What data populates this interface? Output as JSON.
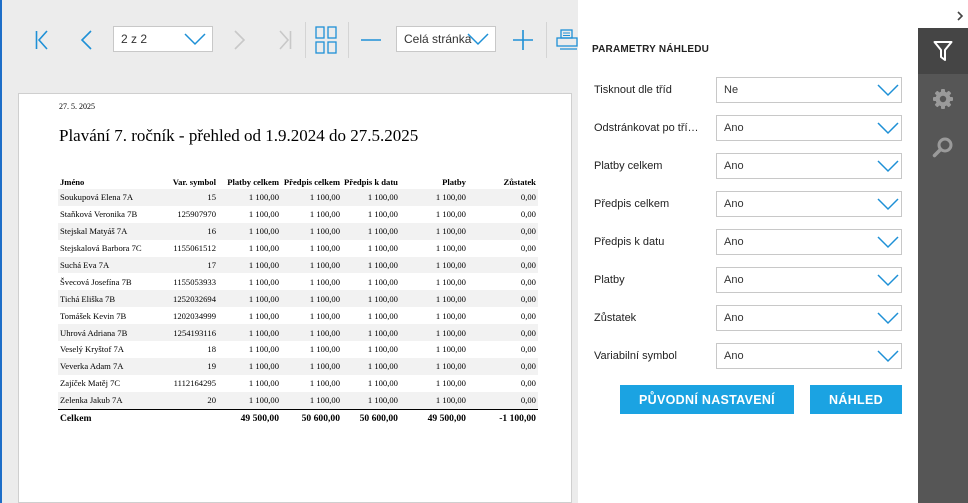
{
  "toolbar": {
    "page_select": "2 z 2",
    "zoom_select": "Celá stránka"
  },
  "report": {
    "date": "27. 5. 2025",
    "title": "Plavání 7. ročník - přehled od 1.9.2024 do 27.5.2025",
    "columns": [
      "Jméno",
      "Var. symbol",
      "Platby celkem",
      "Předpis celkem",
      "Předpis k datu",
      "Platby",
      "Zůstatek"
    ],
    "rows": [
      [
        "Soukupová Elena 7A",
        "15",
        "1 100,00",
        "1 100,00",
        "1 100,00",
        "1 100,00",
        "0,00"
      ],
      [
        "Staňková Veronika 7B",
        "125907970",
        "1 100,00",
        "1 100,00",
        "1 100,00",
        "1 100,00",
        "0,00"
      ],
      [
        "Stejskal Matyáš 7A",
        "16",
        "1 100,00",
        "1 100,00",
        "1 100,00",
        "1 100,00",
        "0,00"
      ],
      [
        "Stejskalová Barbora 7C",
        "1155061512",
        "1 100,00",
        "1 100,00",
        "1 100,00",
        "1 100,00",
        "0,00"
      ],
      [
        "Suchá Eva 7A",
        "17",
        "1 100,00",
        "1 100,00",
        "1 100,00",
        "1 100,00",
        "0,00"
      ],
      [
        "Švecová Josefína 7B",
        "1155053933",
        "1 100,00",
        "1 100,00",
        "1 100,00",
        "1 100,00",
        "0,00"
      ],
      [
        "Tichá Eliška 7B",
        "1252032694",
        "1 100,00",
        "1 100,00",
        "1 100,00",
        "1 100,00",
        "0,00"
      ],
      [
        "Tomášek Kevin 7B",
        "1202034999",
        "1 100,00",
        "1 100,00",
        "1 100,00",
        "1 100,00",
        "0,00"
      ],
      [
        "Uhrová Adriana 7B",
        "1254193116",
        "1 100,00",
        "1 100,00",
        "1 100,00",
        "1 100,00",
        "0,00"
      ],
      [
        "Veselý Kryštof 7A",
        "18",
        "1 100,00",
        "1 100,00",
        "1 100,00",
        "1 100,00",
        "0,00"
      ],
      [
        "Veverka Adam 7A",
        "19",
        "1 100,00",
        "1 100,00",
        "1 100,00",
        "1 100,00",
        "0,00"
      ],
      [
        "Zajíček Matěj 7C",
        "1112164295",
        "1 100,00",
        "1 100,00",
        "1 100,00",
        "1 100,00",
        "0,00"
      ],
      [
        "Zelenka Jakub 7A",
        "20",
        "1 100,00",
        "1 100,00",
        "1 100,00",
        "1 100,00",
        "0,00"
      ]
    ],
    "totals": [
      "Celkem",
      "",
      "49 500,00",
      "50 600,00",
      "50 600,00",
      "49 500,00",
      "-1 100,00"
    ]
  },
  "params": {
    "title": "PARAMETRY NÁHLEDU",
    "rows": [
      {
        "label": "Tisknout dle tříd",
        "value": "Ne"
      },
      {
        "label": "Odstránkovat po třídách",
        "value": "Ano"
      },
      {
        "label": "Platby celkem",
        "value": "Ano"
      },
      {
        "label": "Předpis celkem",
        "value": "Ano"
      },
      {
        "label": "Předpis k datu",
        "value": "Ano"
      },
      {
        "label": "Platby",
        "value": "Ano"
      },
      {
        "label": "Zůstatek",
        "value": "Ano"
      },
      {
        "label": "Variabilní symbol",
        "value": "Ano"
      }
    ],
    "reset_label": "PŮVODNÍ NASTAVENÍ",
    "preview_label": "NÁHLED"
  },
  "rail": {
    "icons": [
      "filter-icon",
      "gear-icon",
      "search-icon"
    ],
    "active": "filter-icon"
  },
  "colors": {
    "accent": "#1ba3e2",
    "toolbar_icon": "#1e90d6",
    "rail": "#565656"
  }
}
